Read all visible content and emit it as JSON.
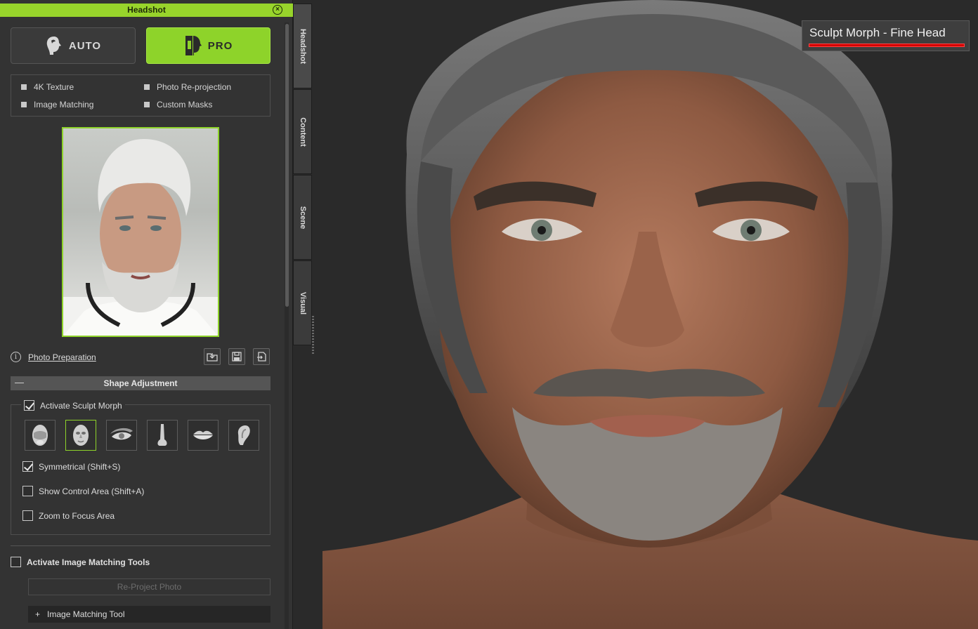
{
  "window": {
    "title": "Headshot"
  },
  "modes": {
    "auto": "AUTO",
    "pro": "PRO"
  },
  "features": {
    "texture_4k": "4K Texture",
    "photo_reprojection": "Photo Re-projection",
    "image_matching": "Image Matching",
    "custom_masks": "Custom Masks"
  },
  "photo_preparation": {
    "link": "Photo Preparation"
  },
  "shape_adjustment": {
    "header": "Shape Adjustment",
    "activate_sculpt": "Activate Sculpt Morph",
    "regions": [
      "face-region-icon",
      "head-region-icon",
      "eye-region-icon",
      "nose-region-icon",
      "lips-region-icon",
      "ear-region-icon"
    ],
    "symmetrical": "Symmetrical (Shift+S)",
    "show_control_area": "Show Control Area (Shift+A)",
    "zoom_focus": "Zoom to Focus Area"
  },
  "image_matching_tools": {
    "activate": "Activate Image Matching Tools",
    "reproject": "Re-Project Photo",
    "tool": "Image Matching Tool"
  },
  "tabs": [
    "Headshot",
    "Content",
    "Scene",
    "Visual"
  ],
  "viewport": {
    "mode_label": "Sculpt Morph - Fine Head"
  },
  "colors": {
    "accent": "#8ed32a",
    "title_bar": "#98d42b",
    "indicator": "#d40000"
  }
}
